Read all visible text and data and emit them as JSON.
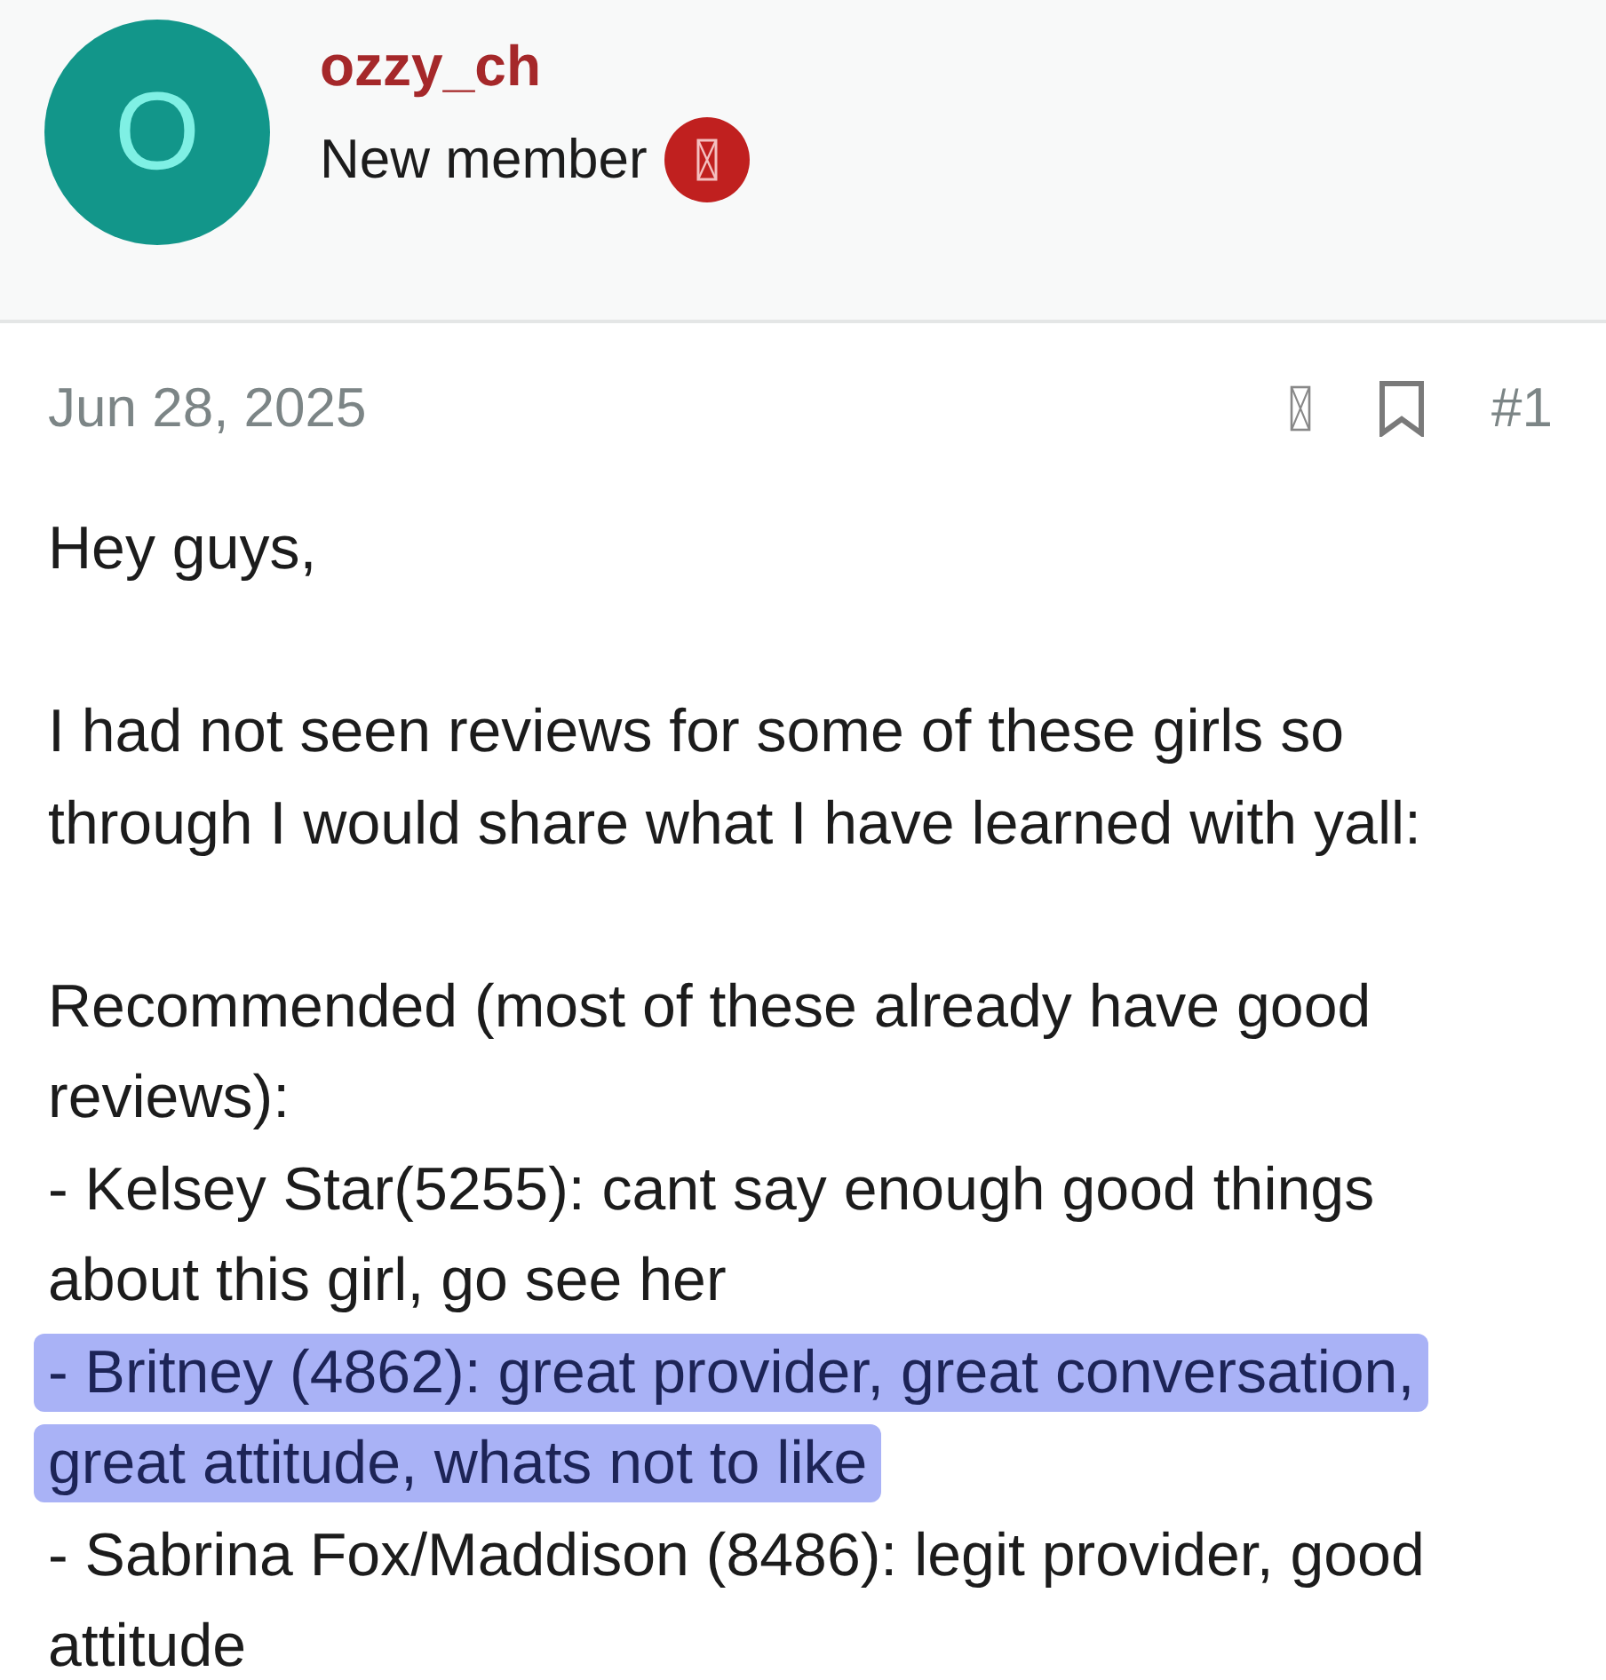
{
  "author": {
    "avatar_letter": "O",
    "username": "ozzy_ch",
    "rank": "New member"
  },
  "post": {
    "date": "Jun 28, 2025",
    "number": "#1",
    "paragraphs": [
      {
        "lines": [
          {
            "text": "Hey guys,",
            "highlighted": false
          }
        ]
      },
      {
        "lines": [
          {
            "text": "I had not seen reviews for some of these girls so",
            "highlighted": false
          },
          {
            "text": "through I would share what I have learned with yall:",
            "highlighted": false
          }
        ]
      },
      {
        "lines": [
          {
            "text": "Recommended (most of these already have good",
            "highlighted": false
          },
          {
            "text": "reviews):",
            "highlighted": false
          },
          {
            "text": "- Kelsey Star(5255): cant say enough good things",
            "highlighted": false
          },
          {
            "text": "about this girl, go see her",
            "highlighted": false
          },
          {
            "text": "- Britney (4862): great provider, great conversation,",
            "highlighted": true
          },
          {
            "text": "great attitude, whats not to like",
            "highlighted": true
          },
          {
            "text": "- Sabrina Fox/Maddison (8486): legit provider, good",
            "highlighted": false
          },
          {
            "text": "attitude",
            "highlighted": false
          }
        ]
      }
    ]
  }
}
